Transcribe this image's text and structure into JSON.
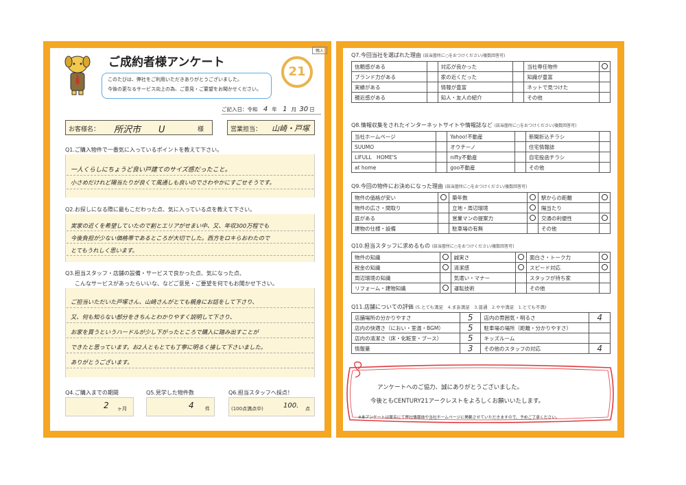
{
  "title": "ご成約者様アンケート",
  "intro": [
    "このたびは、弊社をご利用いただきありがとうございました。",
    "今後の更なるサービス向上の為、ご意見・ご要望をお聞かせください。"
  ],
  "logo": "21",
  "corner_label": "鴨入",
  "date": {
    "label": "ご記入日：令和",
    "year": "4",
    "year_unit": "年",
    "month": "1",
    "month_unit": "月",
    "day": "30",
    "day_unit": "日"
  },
  "customer": {
    "label": "お客様名：",
    "name": "所沢市　　U",
    "honorific": "様"
  },
  "staff": {
    "label": "営業担当：",
    "name": "山崎・戸塚"
  },
  "q1": {
    "label": "Q1.ご購入物件で一番気に入っているポイントを教えて下さい。",
    "answer": [
      "一人くらしにちょうど良い戸建てのサイズ感だったこと。",
      "小さめだけれど陽当たりが良くて風通しも良いのでさわやかにすごせそうです。"
    ]
  },
  "q2": {
    "label": "Q2.お探しになる際に最もこだわった点、気に入っている点を教えて下さい。",
    "answer": [
      "実家の近くを希望していたので割とエリアがせまい中、又、年収300万程でも",
      "今後負担が少ない価格帯であるところが大切でした。西方をロキらおわたので",
      "とてもうれしく思います。"
    ]
  },
  "q3": {
    "label": [
      "Q3.担当スタッフ・店舗の設備・サービスで良かった点、気になった点、",
      "こんなサービスがあったらいいな、などご意見・ご要望を何でもお聞かせ下さい。"
    ],
    "answer": [
      "ご担当いただいた戸塚さん、山崎さんがとても親身にお話をして下さり、",
      "又、何も知らない部分をきちんとわかりやすく説明して下さり、",
      "お家を買うというハードルが少し下がったところで購入に踏み出すことが",
      "できたと思っています。お2人ともとても丁寧に明るく接して下さいました。",
      "ありがとうございます。"
    ]
  },
  "q4": {
    "label": "Q4.ご購入までの期間",
    "value": "2",
    "unit": "ヶ月"
  },
  "q5": {
    "label": "Q5.見学した物件数",
    "value": "4",
    "unit": "件"
  },
  "q6": {
    "label": "Q6.担当スタッフへ採点！",
    "note": "(100点満点中)",
    "value": "100.",
    "unit": "点"
  },
  "q7": {
    "label": "Q7.今回当社を選ばれた理由",
    "note": "(該当箇所に○をおつけください/複数回答可)",
    "rows": [
      [
        "信頼感がある",
        "",
        "対応が良かった",
        "",
        "当社専任物件",
        "○"
      ],
      [
        "ブランド力がある",
        "",
        "家の近くだった",
        "",
        "知識が豊富",
        ""
      ],
      [
        "実績がある",
        "",
        "情報が豊富",
        "",
        "ネットで見つけた",
        ""
      ],
      [
        "親近感がある",
        "",
        "知人・友人の紹介",
        "",
        "その他",
        ""
      ]
    ]
  },
  "q8": {
    "label": "Q8.情報収集をされたインターネットサイトや情報誌など",
    "note": "(該当箇所に○をおつけください/複数回答可)",
    "rows": [
      [
        "当社ホームページ",
        "",
        "Yahoo!不動産",
        "",
        "新聞折込チラシ",
        ""
      ],
      [
        "SUUMO",
        "",
        "オウチーノ",
        "",
        "住宅情報誌",
        ""
      ],
      [
        "LIFULL　HOME'S",
        "",
        "nifty不動産",
        "",
        "自宅投函チラシ",
        ""
      ],
      [
        "at home",
        "",
        "goo不動産",
        "",
        "その他",
        ""
      ]
    ]
  },
  "q9": {
    "label": "Q9.今回の物件にお決めになった理由",
    "note": "(該当箇所に○をおつけください/複数回答可)",
    "rows": [
      [
        "物件の価格が安い",
        "○",
        "築年数",
        "○",
        "駅からの距離",
        "○"
      ],
      [
        "物件の広さ・間取り",
        "",
        "立地・周辺環境",
        "○",
        "陽当たり",
        ""
      ],
      [
        "庭がある",
        "",
        "営業マンの提案力",
        "○",
        "交通の利便性",
        "○"
      ],
      [
        "建物の仕様・設備",
        "",
        "駐車場の有無",
        "",
        "その他",
        ""
      ]
    ]
  },
  "q10": {
    "label": "Q10.担当スタッフに求めるもの",
    "note": "(該当箇所に○をおつけください/複数回答可)",
    "rows": [
      [
        "物件の知識",
        "○",
        "誠実さ",
        "○",
        "面白さ・トーク力",
        "○"
      ],
      [
        "税金の知識",
        "○",
        "清潔感",
        "○",
        "スピード対応",
        "○"
      ],
      [
        "周辺環境の知識",
        "",
        "気遣い・マナー",
        "",
        "スタッフが持ち家",
        ""
      ],
      [
        "リフォーム・建物知識",
        "○",
        "運転技術",
        "",
        "その他",
        ""
      ]
    ]
  },
  "q11": {
    "label": "Q11.店舗についての評価",
    "scale": "(5.とても満足　4.まあ満足　3.普通　2.やや満足　1.とても不満)",
    "rows": [
      [
        "店舗場所の分かりやすさ",
        "5",
        "店内の雰囲気・明るさ",
        "4"
      ],
      [
        "店内の快適さ（におい・室温・BGM）",
        "5",
        "駐車場の場所（距離・分かりやすさ）",
        ""
      ],
      [
        "店内の清潔さ（床・化粧室・ブース）",
        "5",
        "キッズルーム",
        ""
      ],
      [
        "情報量",
        "3",
        "その他のスタッフの対応",
        "4"
      ]
    ]
  },
  "closing": {
    "line1": "アンケートへのご協力、誠にありがとうございました。",
    "line2": "今後ともCENTURY21アークレストをよろしくお願いいたします。",
    "footnote": "※本アンケートは匿名にて弊社情報誌や当社ホームページに掲載させていただきますので、予めご了承ください。"
  },
  "colors": {
    "frame": "#f5a623",
    "ribbon": "#e03a3e",
    "highlight": "#fdf5d8"
  }
}
